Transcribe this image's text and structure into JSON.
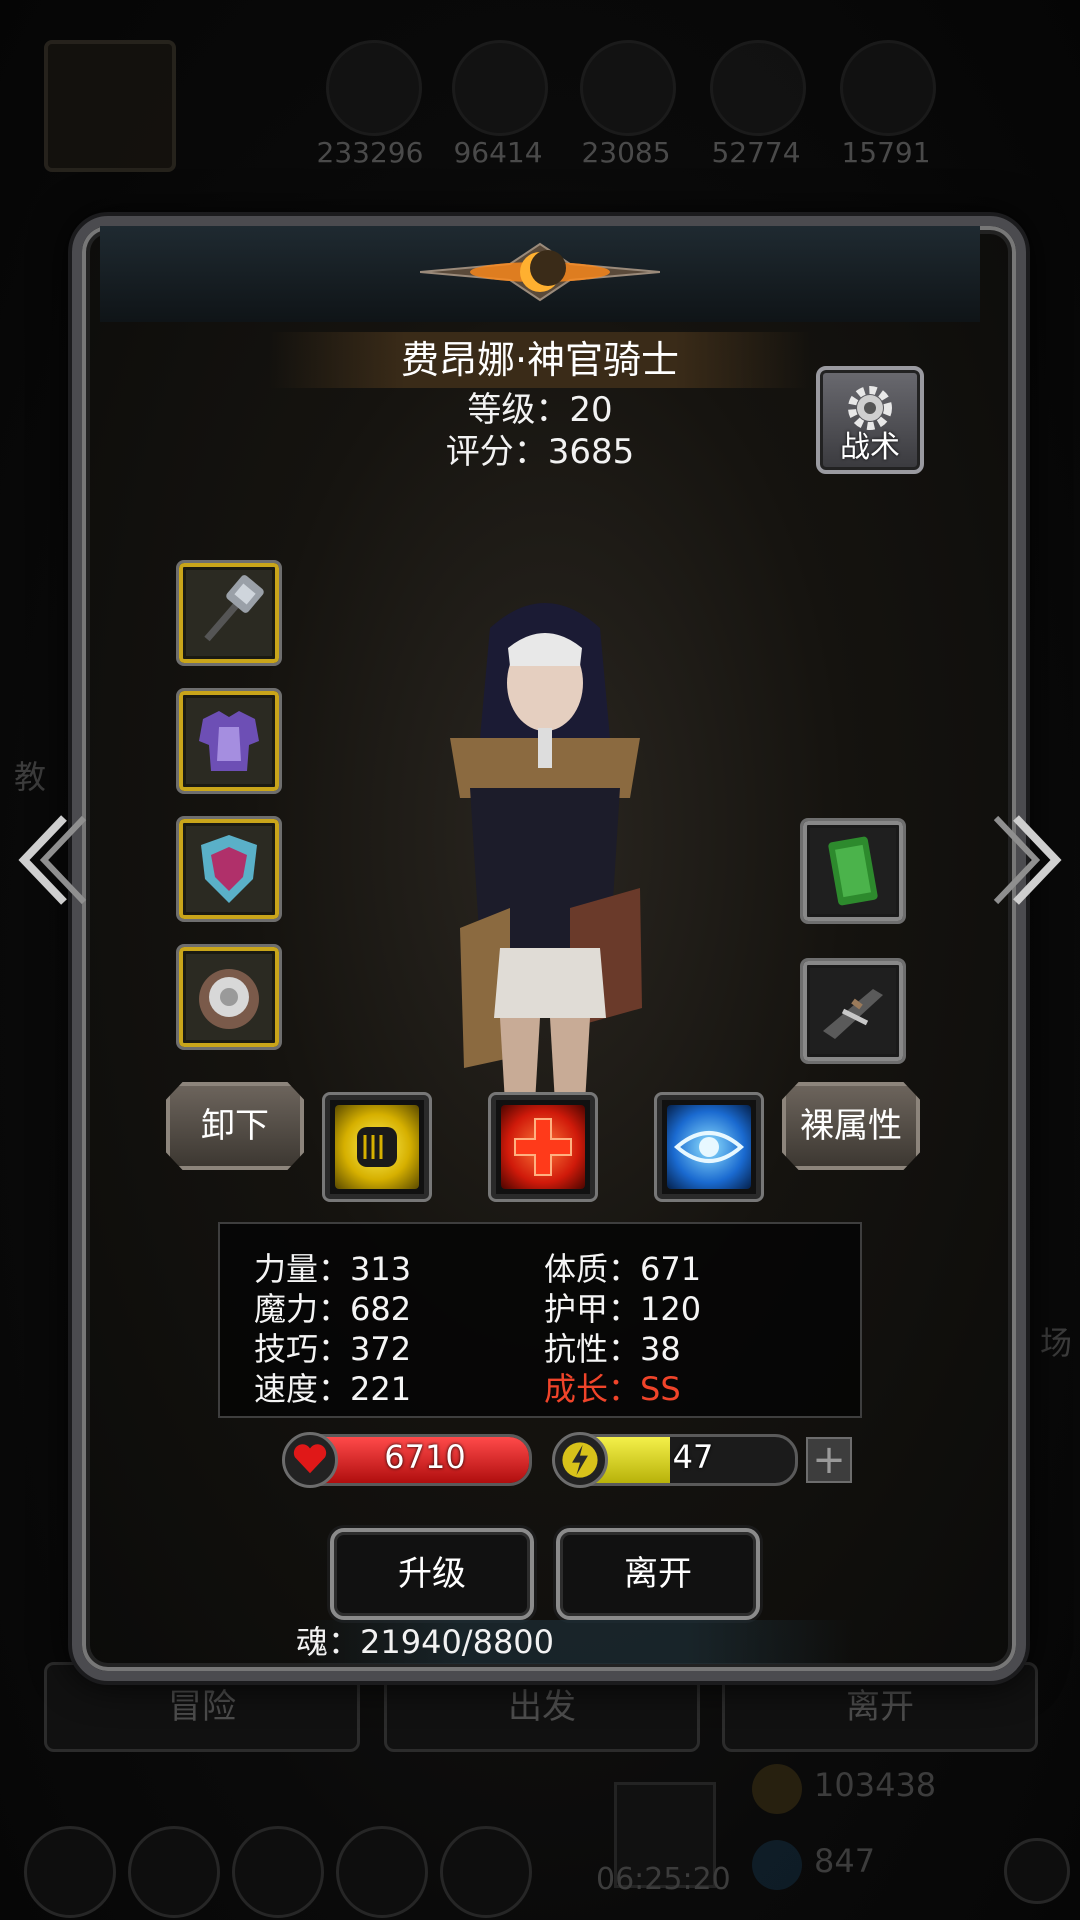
{
  "background": {
    "resources": [
      "233296",
      "96414",
      "23085",
      "52774",
      "15791"
    ],
    "bottom_buttons": [
      "冒险",
      "出发",
      "离开"
    ],
    "gold": "103438",
    "gems": "847",
    "timer": "06:25:20",
    "side_left": "教",
    "side_right": "场"
  },
  "hero": {
    "name": "费昂娜·神官骑士",
    "level_line": "等级：20",
    "score_line": "评分：3685",
    "tactic_label": "战术"
  },
  "buttons": {
    "unequip": "卸下",
    "base_attributes": "裸属性",
    "upgrade": "升级",
    "leave": "离开"
  },
  "equipment": {
    "left": [
      "mace-icon",
      "armor-icon",
      "shield-icon",
      "ring-icon"
    ],
    "right": [
      "card-icon",
      "crossbow-icon"
    ]
  },
  "skills": [
    "fist-icon",
    "cross-icon",
    "eye-icon"
  ],
  "stats": {
    "strength": "力量：313",
    "magic": "魔力：682",
    "skill": "技巧：372",
    "speed": "速度：221",
    "constitution": "体质：671",
    "armor": "护甲：120",
    "resistance": "抗性：38",
    "growth": "成长：SS"
  },
  "bars": {
    "hp": "6710",
    "hp_fill": 1.0,
    "energy": "47",
    "energy_fill": 0.47
  },
  "soul": "魂：21940/8800",
  "colors": {
    "hp": "#d11414",
    "energy": "#d8d41a",
    "growth": "#f0442a"
  }
}
